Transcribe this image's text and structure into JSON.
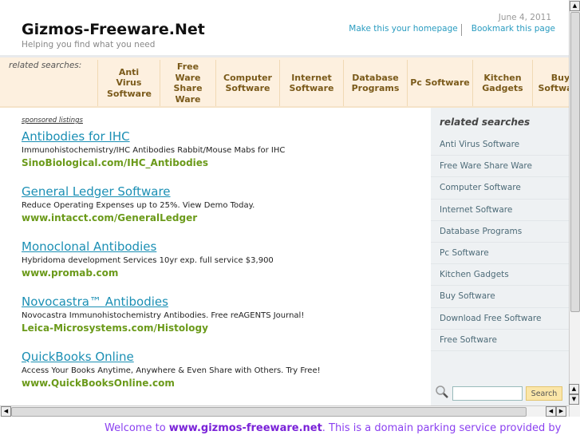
{
  "header": {
    "title": "Gizmos-Freeware.Net",
    "tagline": "Helping you find what you need",
    "date": "June 4, 2011",
    "links": [
      "Make this your homepage",
      "Bookmark this page"
    ]
  },
  "nav": {
    "label": "related searches:",
    "items": [
      {
        "label": "Anti Virus Software"
      },
      {
        "label": "Free Ware Share Ware"
      },
      {
        "label": "Computer Software"
      },
      {
        "label": "Internet Software"
      },
      {
        "label": "Database Programs"
      },
      {
        "label": "Pc Software"
      },
      {
        "label": "Kitchen Gadgets"
      },
      {
        "label": "Buy Software"
      }
    ]
  },
  "main": {
    "sponsored_label": "sponsored listings",
    "ads": [
      {
        "title": "Antibodies for IHC",
        "desc": "Immunohistochemistry/IHC Antibodies Rabbit/Mouse Mabs for IHC",
        "url": "SinoBiological.com/IHC_Antibodies"
      },
      {
        "title": "General Ledger Software",
        "desc": "Reduce Operating Expenses up to 25%. View Demo Today.",
        "url": "www.intacct.com/GeneralLedger"
      },
      {
        "title": "Monoclonal Antibodies",
        "desc": "Hybridoma development Services 10yr exp. full service $3,900",
        "url": "www.promab.com"
      },
      {
        "title": "Novocastra™ Antibodies",
        "desc": "Novocastra Immunohistochemistry Antibodies. Free reAGENTS Journal!",
        "url": "Leica-Microsystems.com/Histology"
      },
      {
        "title": "QuickBooks Online",
        "desc": "Access Your Books Anytime, Anywhere & Even Share with Others. Try Free!",
        "url": "www.QuickBooksOnline.com"
      }
    ]
  },
  "sidebar": {
    "title": "related searches",
    "items": [
      "Anti Virus Software",
      "Free Ware Share Ware",
      "Computer Software",
      "Internet Software",
      "Database Programs",
      "Pc Software",
      "Kitchen Gadgets",
      "Buy Software",
      "Download Free Software",
      "Free Software"
    ]
  },
  "search": {
    "value": "",
    "button": "Search"
  },
  "footer": {
    "pre": "Welcome to ",
    "domain": "www.gizmos-freeware.net",
    "post": ". This is a domain parking service provided by"
  }
}
